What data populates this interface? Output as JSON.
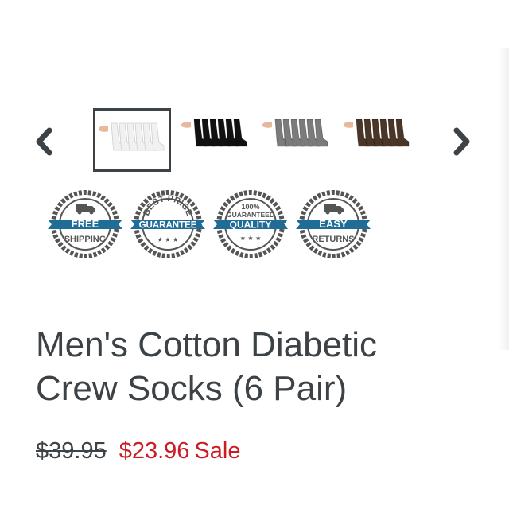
{
  "product": {
    "title_line1": "Men's Cotton Diabetic",
    "title_line2": "Crew Socks (6 Pair)",
    "original_price": "$39.95",
    "sale_price": "$23.96",
    "sale_label": "Sale"
  },
  "carousel": {
    "prev_icon": "chevron-left-icon",
    "next_icon": "chevron-right-icon",
    "thumbnails": [
      {
        "color_name": "white",
        "sock_color": "#f1f1f1",
        "selected": true
      },
      {
        "color_name": "black",
        "sock_color": "#111111",
        "selected": false
      },
      {
        "color_name": "grey",
        "sock_color": "#7b7b7b",
        "selected": false
      },
      {
        "color_name": "brown",
        "sock_color": "#4a3526",
        "selected": false
      }
    ]
  },
  "badges": [
    {
      "line1": "FREE",
      "line2": "SHIPPING",
      "icon": "truck-icon"
    },
    {
      "top": "BEST PRICE",
      "banner": "GUARANTEE",
      "icon": "stars-icon"
    },
    {
      "top": "100%",
      "mid": "GUARANTEED",
      "banner": "QUALITY",
      "icon": "stars-icon"
    },
    {
      "line1": "EASY",
      "line2": "RETURNS",
      "icon": "truck-icon"
    }
  ],
  "colors": {
    "text": "#3d4246",
    "sale": "#cc1c23",
    "badge_blue": "#1f6d96",
    "badge_ring": "#555555"
  }
}
